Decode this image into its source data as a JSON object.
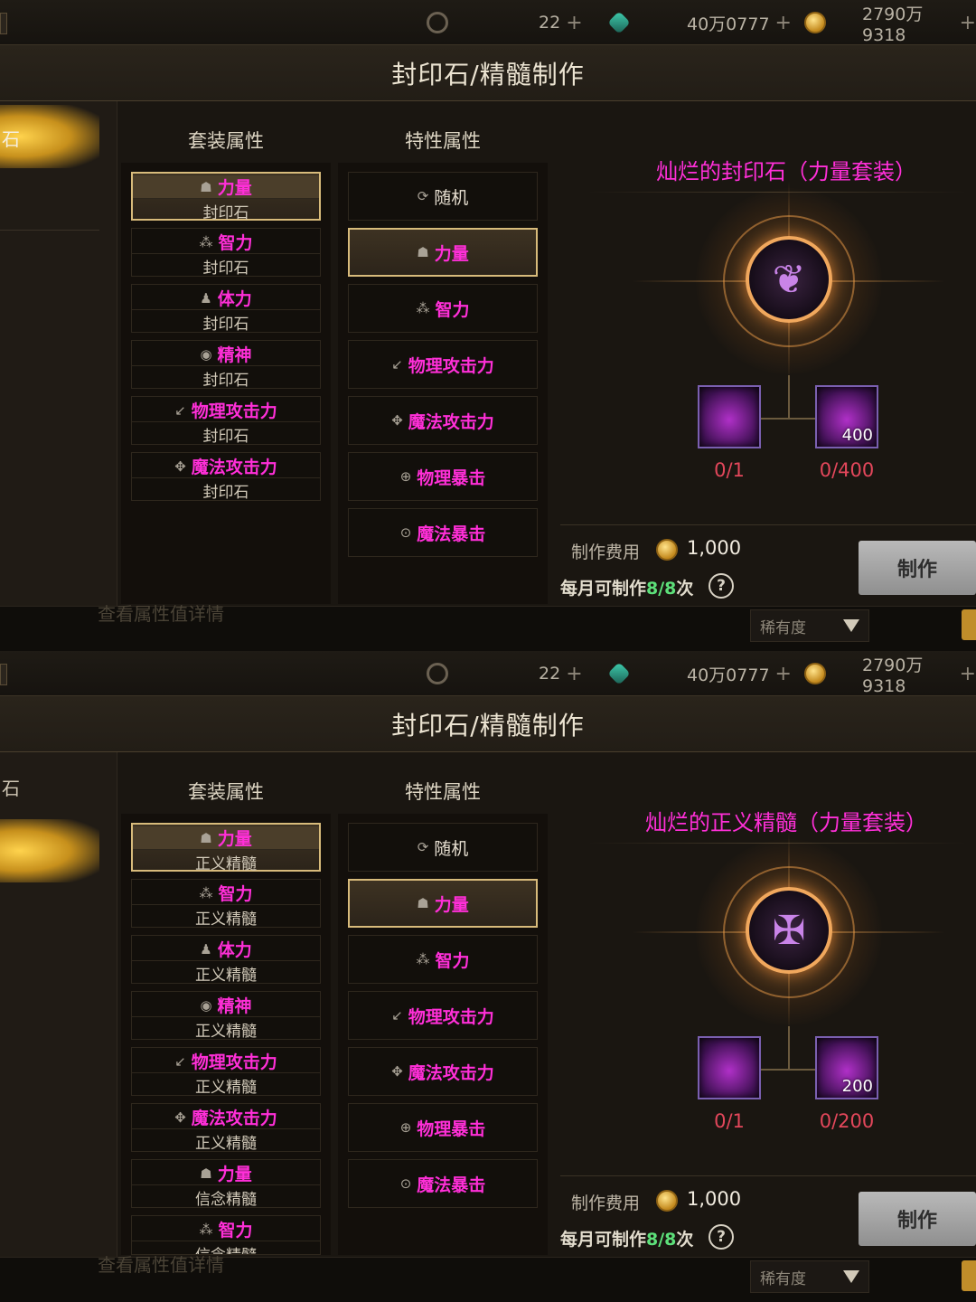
{
  "colors": {
    "attribute_text": "#ff2fd8",
    "item_name": "#ff2fd8",
    "material_count": "#e3475b",
    "monthly_green": "#5de07a",
    "selection_border": "#d8bb7b"
  },
  "panels": [
    {
      "topbar": {
        "icon_1": "cycle-currency-icon",
        "value_1": "22",
        "icon_2": "green-gem-icon",
        "value_2": "40万0777",
        "icon_3": "gold-coin-icon",
        "value_3": "2790万9318",
        "plus": "+"
      },
      "title": "封印石/精髓制作",
      "left_tab": {
        "selected_text": "石",
        "second_text": ""
      },
      "set_header": "套装属性",
      "trait_header": "特性属性",
      "set_items": [
        {
          "icon": "strength-icon",
          "glyph": "☗",
          "name": "力量",
          "sub": "封印石"
        },
        {
          "icon": "intellect-icon",
          "glyph": "⁂",
          "name": "智力",
          "sub": "封印石"
        },
        {
          "icon": "vitality-icon",
          "glyph": "♟",
          "name": "体力",
          "sub": "封印石"
        },
        {
          "icon": "spirit-icon",
          "glyph": "◉",
          "name": "精神",
          "sub": "封印石"
        },
        {
          "icon": "physical-attack-icon",
          "glyph": "↙",
          "name": "物理攻击力",
          "sub": "封印石"
        },
        {
          "icon": "magic-attack-icon",
          "glyph": "✥",
          "name": "魔法攻击力",
          "sub": "封印石"
        }
      ],
      "trait_items": [
        {
          "icon": "random-icon",
          "glyph": "⟳",
          "name": "随机"
        },
        {
          "icon": "strength-icon",
          "glyph": "☗",
          "name": "力量"
        },
        {
          "icon": "intellect-icon",
          "glyph": "⁂",
          "name": "智力"
        },
        {
          "icon": "physical-attack-icon",
          "glyph": "↙",
          "name": "物理攻击力"
        },
        {
          "icon": "magic-attack-icon",
          "glyph": "✥",
          "name": "魔法攻击力"
        },
        {
          "icon": "physical-crit-icon",
          "glyph": "⊕",
          "name": "物理暴击"
        },
        {
          "icon": "magic-crit-icon",
          "glyph": "⊙",
          "name": "魔法暴击"
        }
      ],
      "result_name": "灿烂的封印石（力量套装）",
      "result_icon": "seal-stone-emblem-icon",
      "materials": [
        {
          "icon": "purple-stone-material-icon",
          "qty_label": "",
          "count": "0/1"
        },
        {
          "icon": "purple-shard-material-icon",
          "qty_label": "400",
          "count": "0/400"
        }
      ],
      "cost_label": "制作费用",
      "cost_value": "1,000",
      "monthly_prefix": "每月可制作",
      "monthly_value": "8/8",
      "monthly_suffix": "次",
      "help": "?",
      "make_button": "制作",
      "rarity": "稀有度",
      "ghost_text": "查看属性值详情"
    },
    {
      "topbar": {
        "icon_1": "cycle-currency-icon",
        "value_1": "22",
        "icon_2": "green-gem-icon",
        "value_2": "40万0777",
        "icon_3": "gold-coin-icon",
        "value_3": "2790万9318",
        "plus": "+"
      },
      "title": "封印石/精髓制作",
      "left_tab": {
        "selected_text": "",
        "second_text": "石"
      },
      "set_header": "套装属性",
      "trait_header": "特性属性",
      "set_items": [
        {
          "icon": "strength-icon",
          "glyph": "☗",
          "name": "力量",
          "sub": "正义精髓"
        },
        {
          "icon": "intellect-icon",
          "glyph": "⁂",
          "name": "智力",
          "sub": "正义精髓"
        },
        {
          "icon": "vitality-icon",
          "glyph": "♟",
          "name": "体力",
          "sub": "正义精髓"
        },
        {
          "icon": "spirit-icon",
          "glyph": "◉",
          "name": "精神",
          "sub": "正义精髓"
        },
        {
          "icon": "physical-attack-icon",
          "glyph": "↙",
          "name": "物理攻击力",
          "sub": "正义精髓"
        },
        {
          "icon": "magic-attack-icon",
          "glyph": "✥",
          "name": "魔法攻击力",
          "sub": "正义精髓"
        },
        {
          "icon": "strength-icon",
          "glyph": "☗",
          "name": "力量",
          "sub": "信念精髓"
        },
        {
          "icon": "intellect-icon",
          "glyph": "⁂",
          "name": "智力",
          "sub": "信念精髓"
        }
      ],
      "trait_items": [
        {
          "icon": "random-icon",
          "glyph": "⟳",
          "name": "随机"
        },
        {
          "icon": "strength-icon",
          "glyph": "☗",
          "name": "力量"
        },
        {
          "icon": "intellect-icon",
          "glyph": "⁂",
          "name": "智力"
        },
        {
          "icon": "physical-attack-icon",
          "glyph": "↙",
          "name": "物理攻击力"
        },
        {
          "icon": "magic-attack-icon",
          "glyph": "✥",
          "name": "魔法攻击力"
        },
        {
          "icon": "physical-crit-icon",
          "glyph": "⊕",
          "name": "物理暴击"
        },
        {
          "icon": "magic-crit-icon",
          "glyph": "⊙",
          "name": "魔法暴击"
        }
      ],
      "result_name": "灿烂的正义精髓（力量套装）",
      "result_icon": "justice-essence-emblem-icon",
      "materials": [
        {
          "icon": "purple-stone-material-icon",
          "qty_label": "",
          "count": "0/1"
        },
        {
          "icon": "purple-shard-material-icon",
          "qty_label": "200",
          "count": "0/200"
        }
      ],
      "cost_label": "制作费用",
      "cost_value": "1,000",
      "monthly_prefix": "每月可制作",
      "monthly_value": "8/8",
      "monthly_suffix": "次",
      "help": "?",
      "make_button": "制作",
      "rarity": "稀有度",
      "ghost_text": "查看属性值详情"
    }
  ]
}
